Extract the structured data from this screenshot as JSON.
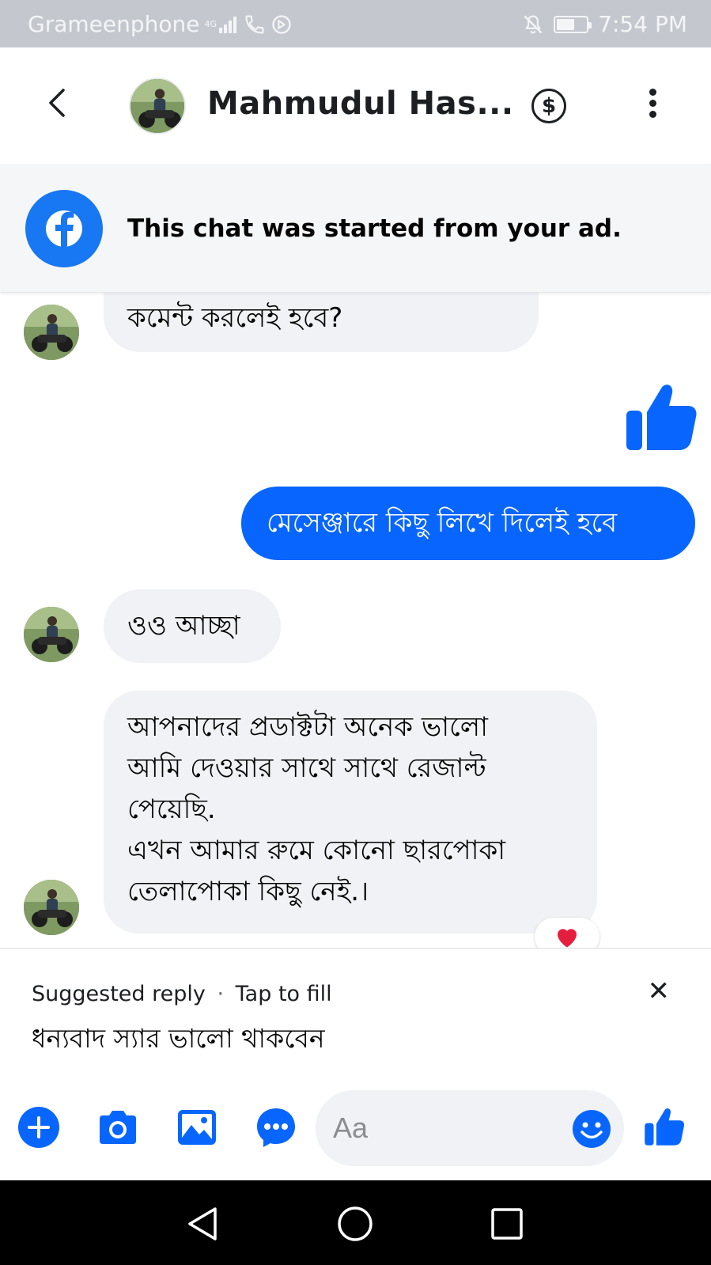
{
  "status_bar": {
    "carrier": "Grameenphone",
    "network": "4G",
    "time": "7:54 PM",
    "battery_level": 0.6
  },
  "header": {
    "contact_name": "Mahmudul Has...",
    "icons": [
      "back-chevron-icon",
      "dollar-icon",
      "more-vertical-icon"
    ]
  },
  "ad_banner": {
    "text": "This chat was started from your ad.",
    "icon": "facebook-logo-icon"
  },
  "messages": [
    {
      "direction": "incoming",
      "text": "কমেন্ট করলেই হবে?"
    },
    {
      "direction": "outgoing",
      "type": "like",
      "icon": "thumbs-up-icon"
    },
    {
      "direction": "outgoing",
      "text": "মেসেঞ্জারে কিছু লিখে দিলেই হবে"
    },
    {
      "direction": "incoming",
      "text": "ওও আচ্ছা"
    },
    {
      "direction": "incoming",
      "lines": [
        "আপনাদের প্রডাক্টটা  অনেক ভালো",
        "আমি দেওয়ার সাথে সাথে রেজাল্ট",
        "পেয়েছি.",
        "এখন আমার রুমে কোনো ছারপোকা",
        "তেলাপোকা কিছু নেই.।"
      ],
      "reaction": "heart"
    }
  ],
  "suggested_reply": {
    "label": "Suggested reply",
    "hint": "Tap to fill",
    "text": "ধন্যবাদ স্যার ভালো থাকবেন"
  },
  "composer": {
    "placeholder": "Aa",
    "icons": [
      "plus-icon",
      "camera-icon",
      "image-icon",
      "chat-more-icon",
      "emoji-icon",
      "thumbs-up-icon"
    ]
  },
  "colors": {
    "accent": "#0866ff",
    "incoming_bubble": "#f0f2f5",
    "status_bar": "#c4c8ce",
    "reaction_heart": "#e41e3f"
  }
}
